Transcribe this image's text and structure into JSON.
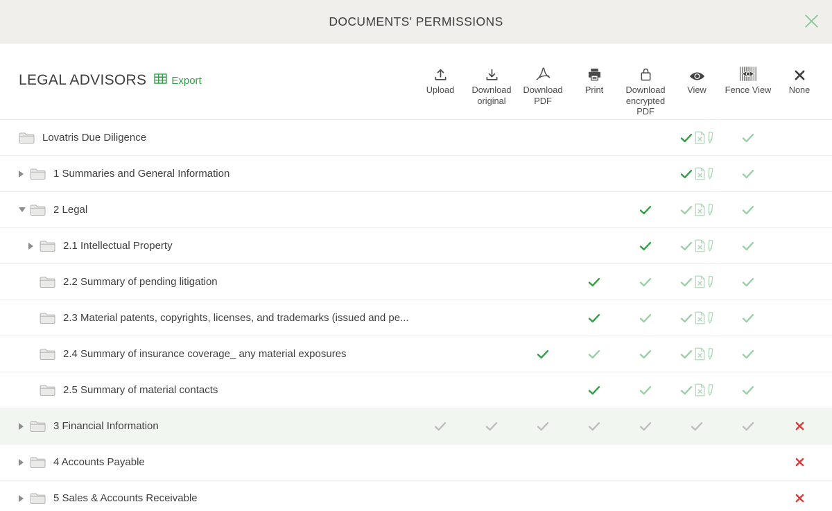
{
  "dialog": {
    "title": "DOCUMENTS' PERMISSIONS"
  },
  "toolbar": {
    "group_title": "LEGAL ADVISORS",
    "export_label": "Export"
  },
  "columns": [
    {
      "id": "upload",
      "label": "Upload",
      "icon": "upload-icon"
    },
    {
      "id": "download_original",
      "label": "Download original",
      "icon": "download-icon"
    },
    {
      "id": "download_pdf",
      "label": "Download PDF",
      "icon": "pdf-icon"
    },
    {
      "id": "print",
      "label": "Print",
      "icon": "printer-icon"
    },
    {
      "id": "download_encrypted_pdf",
      "label": "Download encrypted PDF",
      "icon": "lock-icon"
    },
    {
      "id": "view",
      "label": "View",
      "icon": "eye-icon"
    },
    {
      "id": "fence_view",
      "label": "Fence View",
      "icon": "fence-eye-icon"
    },
    {
      "id": "none",
      "label": "None",
      "icon": "x-icon"
    }
  ],
  "colors": {
    "accent_green": "#2f9e44",
    "check_dark": "#2f9e44",
    "check_light": "#9bcfa6",
    "check_grey": "#bdbdbd",
    "x_red": "#d0413b",
    "header_bg": "#f0efeb",
    "row_highlight": "#f1f6f0",
    "close_x_green": "#7fca8f"
  },
  "rows": [
    {
      "label": "Lovatris Due Diligence",
      "indent": 0,
      "expander": "none",
      "highlighted": false,
      "cells": [
        "",
        "",
        "",
        "",
        "",
        "dark+doc",
        "light",
        ""
      ]
    },
    {
      "label": "1 Summaries and General Information",
      "indent": 0,
      "expander": "collapsed",
      "highlighted": false,
      "cells": [
        "",
        "",
        "",
        "",
        "",
        "dark+doc",
        "light",
        ""
      ]
    },
    {
      "label": "2 Legal",
      "indent": 0,
      "expander": "expanded",
      "highlighted": false,
      "cells": [
        "",
        "",
        "",
        "",
        "dark",
        "light+doc",
        "light",
        ""
      ]
    },
    {
      "label": "2.1 Intellectual Property",
      "indent": 1,
      "expander": "collapsed",
      "highlighted": false,
      "cells": [
        "",
        "",
        "",
        "",
        "dark",
        "light+doc",
        "light",
        ""
      ]
    },
    {
      "label": "2.2 Summary of pending litigation",
      "indent": 1,
      "expander": "none",
      "highlighted": false,
      "cells": [
        "",
        "",
        "",
        "dark",
        "light",
        "light+doc",
        "light",
        ""
      ]
    },
    {
      "label": "2.3 Material patents, copyrights, licenses, and trademarks (issued and pe...",
      "indent": 1,
      "expander": "none",
      "highlighted": false,
      "cells": [
        "",
        "",
        "",
        "dark",
        "light",
        "light+doc",
        "light",
        ""
      ]
    },
    {
      "label": "2.4 Summary of insurance coverage_ any material exposures",
      "indent": 1,
      "expander": "none",
      "highlighted": false,
      "cells": [
        "",
        "",
        "dark",
        "light",
        "light",
        "light+doc",
        "light",
        ""
      ]
    },
    {
      "label": "2.5 Summary of material contacts",
      "indent": 1,
      "expander": "none",
      "highlighted": false,
      "cells": [
        "",
        "",
        "",
        "dark",
        "light",
        "light+doc",
        "light",
        ""
      ]
    },
    {
      "label": "3 Financial Information",
      "indent": 0,
      "expander": "collapsed",
      "highlighted": true,
      "cells": [
        "grey",
        "grey",
        "grey",
        "grey",
        "grey",
        "grey",
        "grey",
        "x"
      ]
    },
    {
      "label": "4 Accounts Payable",
      "indent": 0,
      "expander": "collapsed",
      "highlighted": false,
      "cells": [
        "",
        "",
        "",
        "",
        "",
        "",
        "",
        "x"
      ]
    },
    {
      "label": "5 Sales & Accounts Receivable",
      "indent": 0,
      "expander": "collapsed",
      "highlighted": false,
      "cells": [
        "",
        "",
        "",
        "",
        "",
        "",
        "",
        "x"
      ]
    }
  ]
}
